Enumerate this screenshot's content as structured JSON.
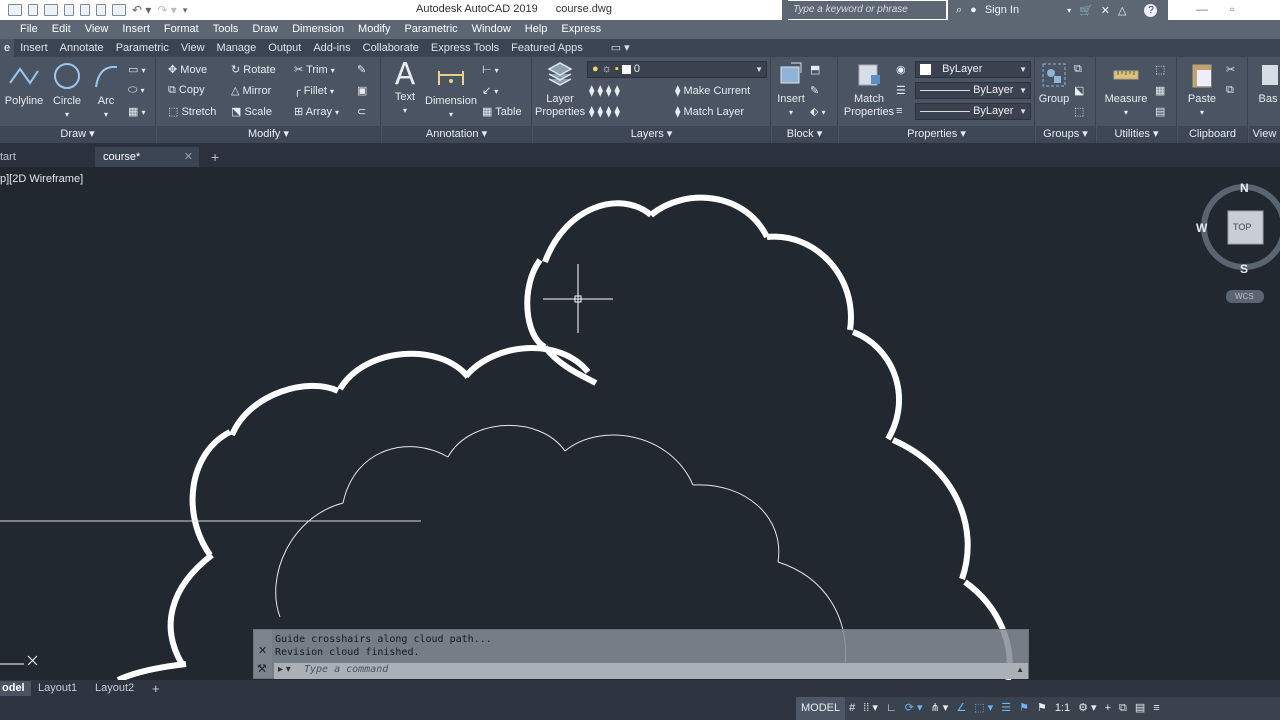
{
  "titlebar": {
    "app": "Autodesk AutoCAD 2019",
    "file": "course.dwg",
    "search_placeholder": "Type a keyword or phrase",
    "sign_in": "Sign In"
  },
  "menu": [
    "File",
    "Edit",
    "View",
    "Insert",
    "Format",
    "Tools",
    "Draw",
    "Dimension",
    "Modify",
    "Parametric",
    "Window",
    "Help",
    "Express"
  ],
  "ribbon_tabs": [
    "e",
    "Insert",
    "Annotate",
    "Parametric",
    "View",
    "Manage",
    "Output",
    "Add-ins",
    "Collaborate",
    "Express Tools",
    "Featured Apps"
  ],
  "ribbon": {
    "draw": {
      "title": "Draw",
      "polyline": "Polyline",
      "circle": "Circle",
      "arc": "Arc"
    },
    "modify": {
      "title": "Modify",
      "move": "Move",
      "rotate": "Rotate",
      "trim": "Trim",
      "copy": "Copy",
      "mirror": "Mirror",
      "fillet": "Fillet",
      "stretch": "Stretch",
      "scale": "Scale",
      "array": "Array"
    },
    "annotation": {
      "title": "Annotation",
      "text": "Text",
      "dimension": "Dimension",
      "table": "Table"
    },
    "layers": {
      "title": "Layers",
      "layer_properties": "Layer Properties",
      "current_layer": "0",
      "make_current": "Make Current",
      "match_layer": "Match Layer"
    },
    "block": {
      "title": "Block",
      "insert": "Insert"
    },
    "properties": {
      "title": "Properties",
      "match_properties": "Match Properties",
      "color": "ByLayer",
      "linetype": "ByLayer",
      "lineweight": "ByLayer"
    },
    "groups": {
      "title": "Groups",
      "group": "Group"
    },
    "utilities": {
      "title": "Utilities",
      "measure": "Measure"
    },
    "clipboard": {
      "title": "Clipboard",
      "paste": "Paste"
    },
    "view": {
      "title": "View",
      "base": "Bas"
    }
  },
  "doc_tabs": {
    "start": "tart",
    "active": "course*"
  },
  "viewport_label": "p][2D Wireframe]",
  "viewcube": {
    "n": "N",
    "s": "S",
    "w": "W",
    "top": "TOP",
    "wcs": "WCS"
  },
  "command": {
    "history": [
      "Guide crosshairs along cloud path...",
      "Revision cloud finished."
    ],
    "placeholder": "Type a command"
  },
  "layout_tabs": [
    "odel",
    "Layout1",
    "Layout2"
  ],
  "status": {
    "model": "MODEL",
    "scale": "1:1"
  },
  "colors": {
    "canvas": "#212830",
    "ribbon": "#4a5463",
    "menubar": "#5c6773"
  }
}
